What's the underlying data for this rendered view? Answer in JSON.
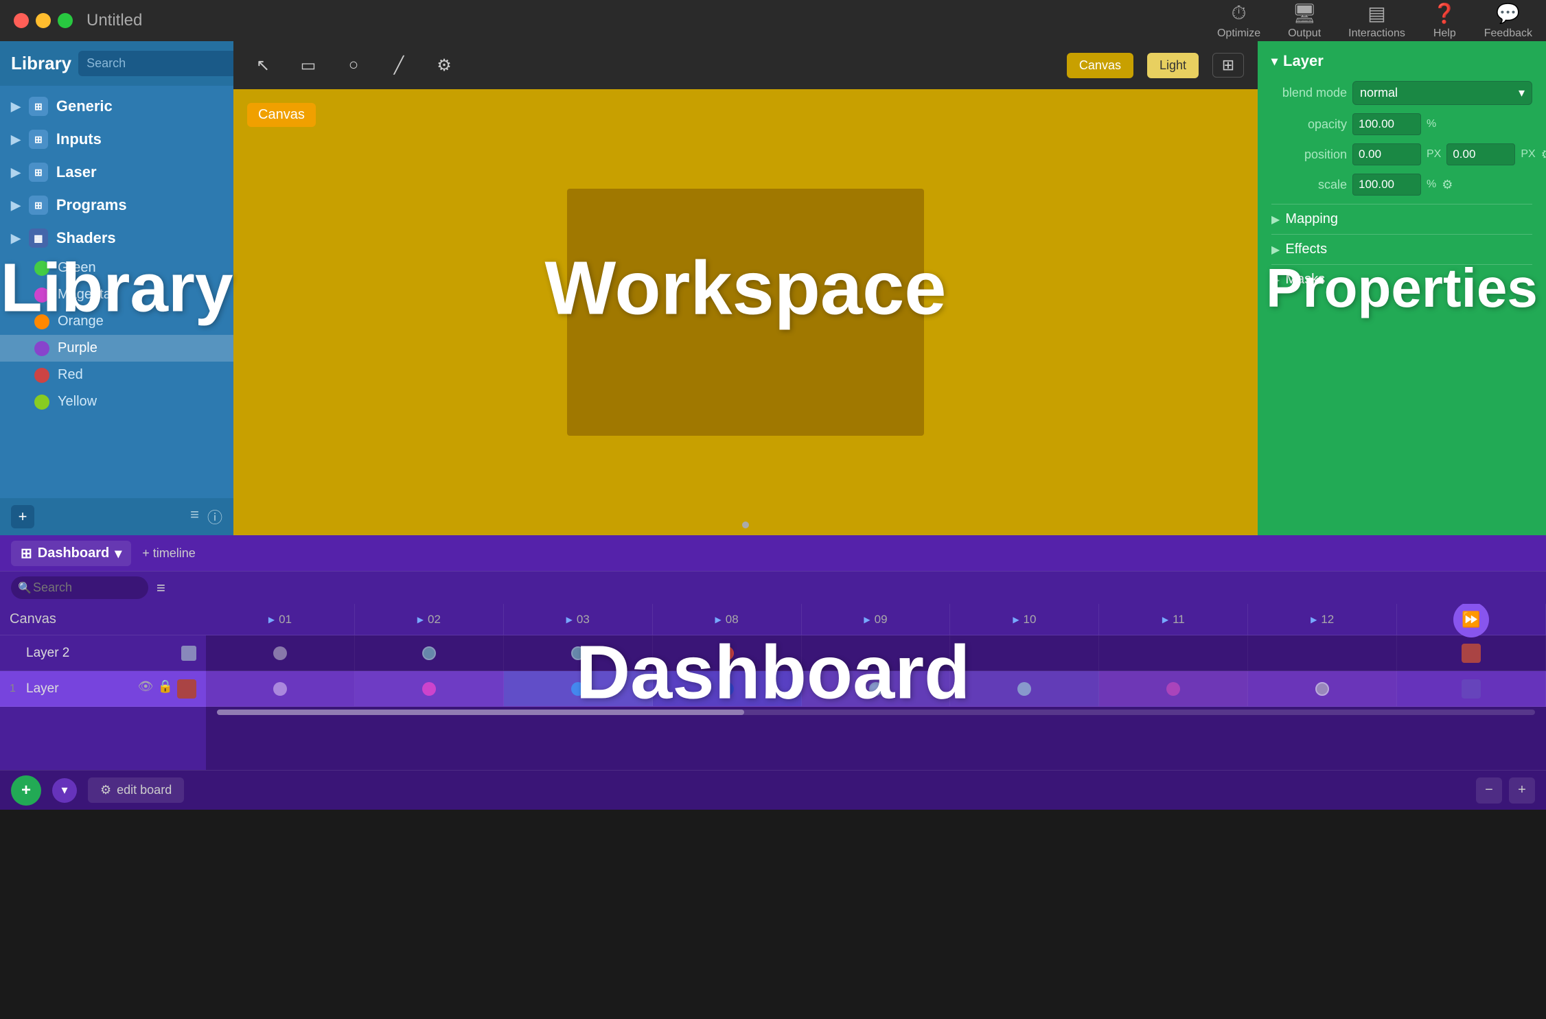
{
  "titlebar": {
    "title": "Untitled",
    "traffic": [
      "red",
      "yellow",
      "green"
    ],
    "toolbar": [
      {
        "label": "Optimize",
        "icon": "⏱"
      },
      {
        "label": "Output",
        "icon": "🖥"
      },
      {
        "label": "Interactions",
        "icon": "▤"
      },
      {
        "label": "Help",
        "icon": "?"
      },
      {
        "label": "Feedback",
        "icon": "💬"
      }
    ]
  },
  "library": {
    "title": "Library",
    "big_label": "Library",
    "search_placeholder": "Search",
    "categories": [
      {
        "name": "Generic"
      },
      {
        "name": "Inputs"
      },
      {
        "name": "Laser"
      },
      {
        "name": "Programs"
      },
      {
        "name": "Shaders"
      }
    ],
    "items": [
      {
        "name": "Green",
        "color": "#44cc44"
      },
      {
        "name": "Magenta",
        "color": "#cc44cc"
      },
      {
        "name": "Orange",
        "color": "#ff8800"
      },
      {
        "name": "Purple",
        "color": "#8844cc",
        "selected": true
      },
      {
        "name": "Red",
        "color": "#cc3333"
      },
      {
        "name": "Yellow",
        "color": "#88cc22"
      }
    ]
  },
  "workspace": {
    "big_label": "Workspace",
    "canvas_label": "Canvas",
    "toolbar": {
      "canvas_btn": "Canvas",
      "light_btn": "Light"
    }
  },
  "properties": {
    "big_label": "Properties",
    "section_title": "Layer",
    "blend_mode": "normal",
    "opacity": "100.00",
    "position_x": "0.00",
    "position_y": "0.00",
    "scale": "100.00",
    "collapsible": [
      "Mapping",
      "Effects",
      "Masks"
    ]
  },
  "dashboard": {
    "big_label": "Dashboard",
    "title": "Dashboard",
    "add_timeline": "+ timeline",
    "search_placeholder": "Search",
    "layers": [
      {
        "name": "Canvas",
        "num": ""
      },
      {
        "name": "Layer 2",
        "num": ""
      },
      {
        "name": "Layer",
        "num": "1"
      }
    ],
    "track_headers": [
      "01",
      "02",
      "03",
      "08",
      "09",
      "10",
      "11",
      "12"
    ],
    "edit_board": "edit board",
    "zoom_minus": "−",
    "zoom_plus": "+"
  }
}
